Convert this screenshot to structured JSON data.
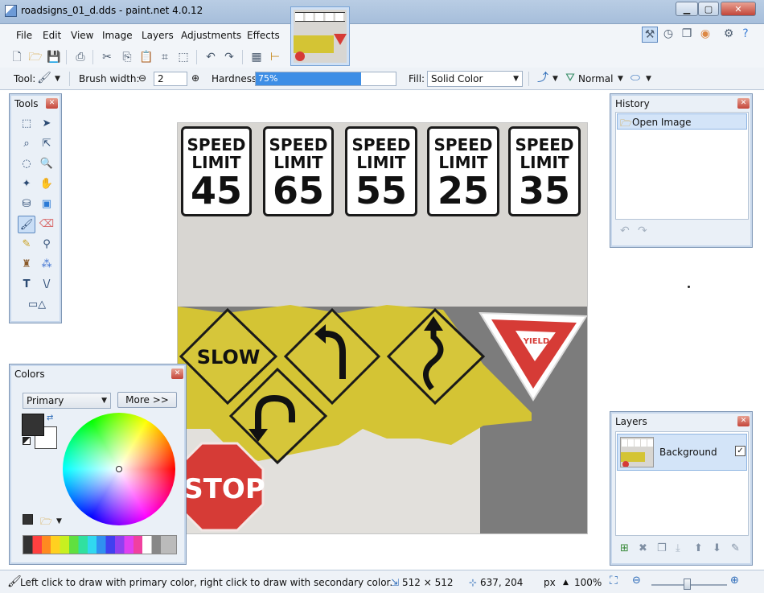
{
  "window": {
    "title": "roadsigns_01_d.dds - paint.net 4.0.12"
  },
  "menu": [
    "File",
    "Edit",
    "View",
    "Image",
    "Layers",
    "Adjustments",
    "Effects"
  ],
  "toolbar": {
    "tool_label": "Tool:",
    "brush_width_label": "Brush width:",
    "brush_width_value": "2",
    "hardness_label": "Hardness:",
    "hardness_value": "75%",
    "hardness_fraction": 0.75,
    "fill_label": "Fill:",
    "fill_value": "Solid Color",
    "blend_mode": "Normal"
  },
  "panels": {
    "tools_title": "Tools",
    "history_title": "History",
    "history_items": [
      "Open Image"
    ],
    "layers_title": "Layers",
    "layers": [
      {
        "name": "Background",
        "visible": true
      }
    ],
    "colors_title": "Colors",
    "colors_mode": "Primary",
    "colors_more": "More >>",
    "primary_color": "#333333",
    "secondary_color": "#ffffff"
  },
  "canvas": {
    "signs_speed": [
      {
        "line1": "SPEED",
        "line2": "LIMIT",
        "value": "45"
      },
      {
        "line1": "SPEED",
        "line2": "LIMIT",
        "value": "65"
      },
      {
        "line1": "SPEED",
        "line2": "LIMIT",
        "value": "55"
      },
      {
        "line1": "SPEED",
        "line2": "LIMIT",
        "value": "25"
      },
      {
        "line1": "SPEED",
        "line2": "LIMIT",
        "value": "35"
      }
    ],
    "slow_text": "SLOW",
    "yield_text": "YIELD",
    "stop_text": "STOP"
  },
  "status": {
    "hint": "Left click to draw with primary color, right click to draw with secondary color.",
    "image_size": "512 × 512",
    "cursor_pos": "637, 204",
    "unit": "px",
    "zoom": "100%"
  },
  "colors": {
    "accent": "#3d7fd6",
    "sign_yellow": "#d4c434",
    "stop_red": "#d63b36"
  }
}
